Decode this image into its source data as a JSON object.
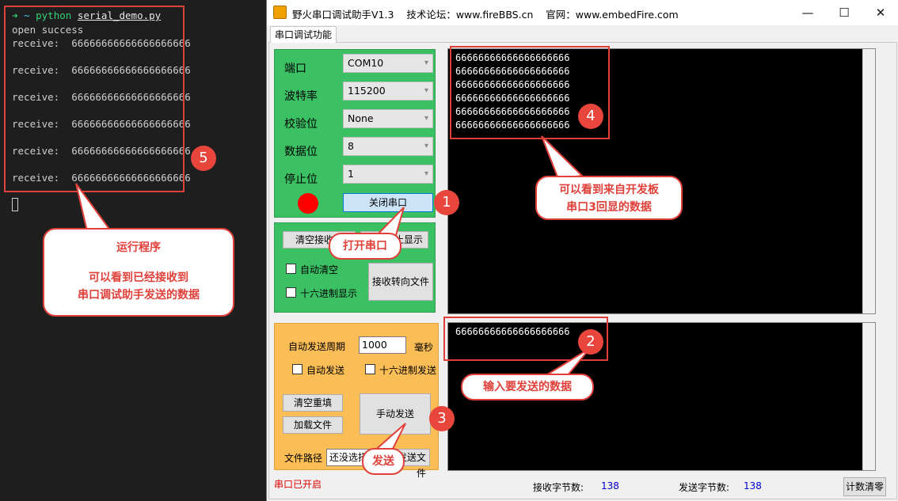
{
  "terminal": {
    "prompt_arrow": "➜",
    "prompt_tilde": "~",
    "command": "python",
    "script": "serial_demo.py",
    "open_status": "open success",
    "receive_prefix": "receive:",
    "receive_data": "66666666666666666666",
    "receive_count": 6
  },
  "window": {
    "title": "野火串口调试助手V1.3    技术论坛：www.fireBBS.cn    官网：www.embedFire.com",
    "tab": "串口调试功能",
    "minimize": "—",
    "maximize": "☐",
    "close": "✕"
  },
  "settings": {
    "port_label": "端口",
    "port_value": "COM10",
    "baud_label": "波特率",
    "baud_value": "115200",
    "parity_label": "校验位",
    "parity_value": "None",
    "databits_label": "数据位",
    "databits_value": "8",
    "stopbits_label": "停止位",
    "stopbits_value": "1",
    "close_port_button": "关闭串口",
    "indicator_color": "#ff0000"
  },
  "receive_options": {
    "clear_receive_button": "清空接收区",
    "stop_display_button": "停止显示",
    "auto_clear": "自动清空",
    "hex_display": "十六进制显示",
    "receive_to_file_button": "接收转向文件"
  },
  "send_options": {
    "period_label": "自动发送周期",
    "period_value": "1000",
    "period_unit": "毫秒",
    "auto_send": "自动发送",
    "hex_send": "十六进制发送",
    "clear_refill_button": "清空重填",
    "load_file_button": "加载文件",
    "manual_send_button": "手动发送",
    "file_path_label": "文件路径",
    "file_path_value": "还没选择文件",
    "send_file_button": "发送文件"
  },
  "receive_area": {
    "lines": [
      "66666666666666666666",
      "66666666666666666666",
      "66666666666666666666",
      "66666666666666666666",
      "66666666666666666666",
      "66666666666666666666"
    ]
  },
  "send_area": {
    "text": "66666666666666666666"
  },
  "status": {
    "port_state": "串口已开启",
    "rx_label": "接收字节数:",
    "rx_value": "138",
    "tx_label": "发送字节数:",
    "tx_value": "138",
    "reset_button": "计数清零"
  },
  "annotations": {
    "step1": "1",
    "step2": "2",
    "step3": "3",
    "step4": "4",
    "step5": "5",
    "open_port": "打开串口",
    "input_data": "输入要发送的数据",
    "send": "发送",
    "echo_line1": "可以看到来自开发板",
    "echo_line2": "串口3回显的数据",
    "run_line1": "运行程序",
    "run_line2": "可以看到已经接收到",
    "run_line3": "串口调试助手发送的数据",
    "color": "#e0403a"
  }
}
